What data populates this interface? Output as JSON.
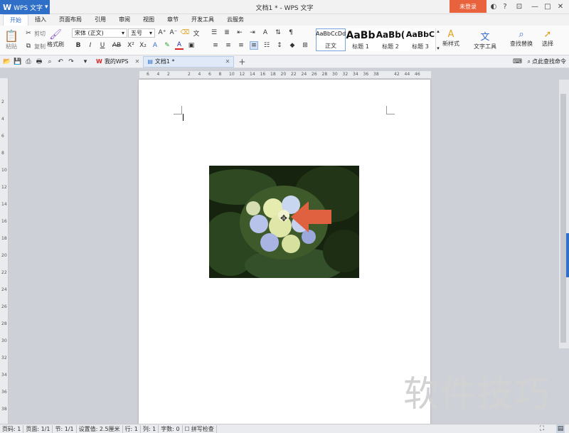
{
  "window": {
    "app_name": "WPS 文字",
    "title": "文档1 * - WPS 文字",
    "login_label": "未登录",
    "help_label": "?",
    "controls": [
      "minimize-icon",
      "maximize-icon",
      "close-icon"
    ]
  },
  "menu": {
    "tabs": [
      "开始",
      "插入",
      "页面布局",
      "引用",
      "审阅",
      "视图",
      "章节",
      "开发工具",
      "云服务"
    ]
  },
  "ribbon": {
    "paste_label": "粘贴",
    "cut_label": "剪切",
    "copy_label": "复制",
    "format_painter_label": "格式刷",
    "font_name": "宋体 (正文)",
    "font_size": "五号",
    "bold": "B",
    "italic": "I",
    "underline": "U",
    "strike": "AB",
    "superscript": "X²",
    "subscript": "X₂",
    "styles": [
      {
        "sample": "AaBbCcDd",
        "label": "正文"
      },
      {
        "sample": "AaBb",
        "label": "标题 1"
      },
      {
        "sample": "AaBb(",
        "label": "标题 2"
      },
      {
        "sample": "AaBbC",
        "label": "标题 3"
      }
    ],
    "new_style_label": "新样式",
    "text_tools_label": "文字工具",
    "find_replace_label": "查找替换",
    "select_label": "选择"
  },
  "quickbar": {
    "my_wps_label": "我的WPS",
    "doc_tab_label": "文档1 *",
    "add_tab": "+",
    "search_label": "点此查找命令"
  },
  "ruler": {
    "h_ticks": [
      "6",
      "4",
      "2",
      "",
      "2",
      "4",
      "6",
      "8",
      "10",
      "12",
      "14",
      "16",
      "18",
      "20",
      "22",
      "24",
      "26",
      "28",
      "30",
      "32",
      "34",
      "36",
      "38",
      "",
      "42",
      "44",
      "46"
    ],
    "v_ticks": [
      "2",
      "4",
      "6",
      "8",
      "10",
      "12",
      "14",
      "16",
      "18",
      "20",
      "22",
      "24",
      "26",
      "28",
      "30",
      "32",
      "34",
      "36",
      "38"
    ]
  },
  "status": {
    "page_code": "页码: 1",
    "page": "页面: 1/1",
    "section": "节: 1/1",
    "setting": "设置值: 2.5厘米",
    "row": "行: 1",
    "col": "列: 1",
    "words": "字数: 0",
    "spell": "拼写检查"
  },
  "watermark": "软件技巧",
  "colors": {
    "accent": "#2f6fc7",
    "login": "#e8623d",
    "arrow": "#e0613f"
  }
}
